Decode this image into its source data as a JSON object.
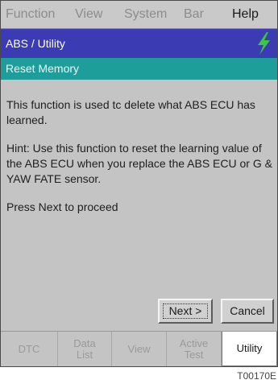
{
  "menubar": {
    "items": [
      "Function",
      "View",
      "System",
      "Bar",
      "Help"
    ],
    "active": "Help"
  },
  "titlebar": {
    "title": "ABS / Utility",
    "icon": "lightning-bolt-icon",
    "icon_color": "#3cc83c"
  },
  "subtitlebar": {
    "subtitle": "Reset Memory"
  },
  "content": {
    "paragraph_1": "This function is used tc delete what ABS ECU has learned.",
    "paragraph_2": "Hint: Use this function to reset the learning value of the ABS ECU when you replace the ABS ECU or G & YAW FATE sensor.",
    "paragraph_3": "Press Next to proceed"
  },
  "buttons": {
    "next_label": "Next >",
    "cancel_label": "Cancel"
  },
  "tabs": {
    "dtc": "DTC",
    "data_list_line1": "Data",
    "data_list_line2": "List",
    "view": "View",
    "active_test_line1": "Active",
    "active_test_line2": "Test",
    "utility": "Utility",
    "selected": "Utility"
  },
  "figure_id": "T00170E",
  "colors": {
    "title_bar": "#3b3bb3",
    "subtitle_bar": "#1e9e9a",
    "panel": "#c4c4c4"
  }
}
